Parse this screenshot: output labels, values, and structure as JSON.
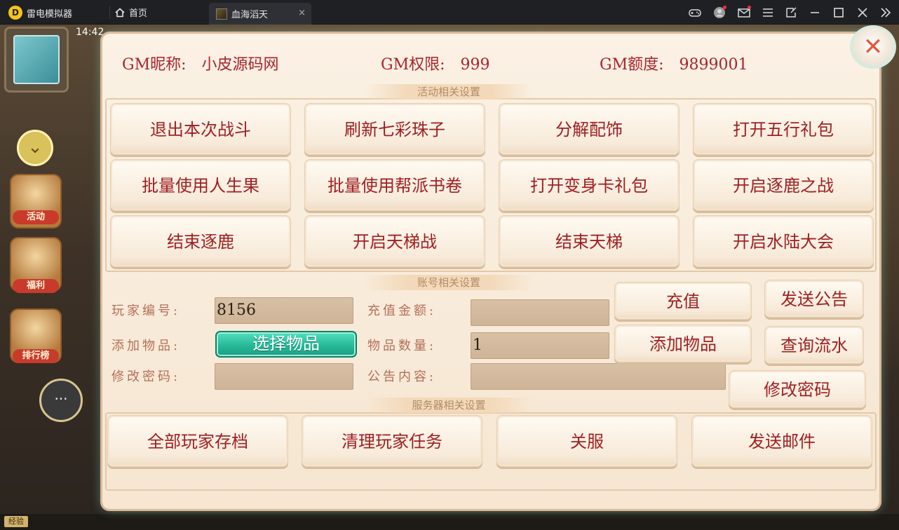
{
  "emulator": {
    "app_name": "雷电模拟器",
    "home_tab": "首页",
    "game_tab": "血海滔天",
    "tab_close": "×"
  },
  "hud": {
    "time": "14:42",
    "side_labels": [
      "活动",
      "福利",
      "排行榜"
    ],
    "exp_label": "经验"
  },
  "gm": {
    "nickname_label": "GM昵称:",
    "nickname": "小皮源码网",
    "permission_label": "GM权限:",
    "permission": "999",
    "quota_label": "GM额度:",
    "quota": "9899001"
  },
  "activity": {
    "title": "活动相关设置",
    "buttons": [
      "退出本次战斗",
      "刷新七彩珠子",
      "分解配饰",
      "打开五行礼包",
      "批量使用人生果",
      "批量使用帮派书卷",
      "打开变身卡礼包",
      "开启逐鹿之战",
      "结束逐鹿",
      "开启天梯战",
      "结束天梯",
      "开启水陆大会"
    ]
  },
  "account": {
    "title": "账号相关设置",
    "player_id_label": "玩家编号:",
    "player_id": "8156",
    "add_item_label": "添加物品:",
    "select_item_button": "选择物品",
    "change_password_label": "修改密码:",
    "password": "",
    "recharge_amount_label": "充值金额:",
    "recharge_amount": "",
    "item_quantity_label": "物品数量:",
    "item_quantity": "1",
    "announcement_label": "公告内容:",
    "announcement": "",
    "recharge_button": "充值",
    "send_announcement_button": "发送公告",
    "add_item_button": "添加物品",
    "query_flow_button": "查询流水",
    "change_password_button": "修改密码"
  },
  "server": {
    "title": "服务器相关设置",
    "buttons": [
      "全部玩家存档",
      "清理玩家任务",
      "关服",
      "发送邮件"
    ]
  },
  "colors": {
    "accent_red": "#a8232b",
    "teal_button": "#25b596",
    "panel_bg": "#fbf1e4"
  }
}
